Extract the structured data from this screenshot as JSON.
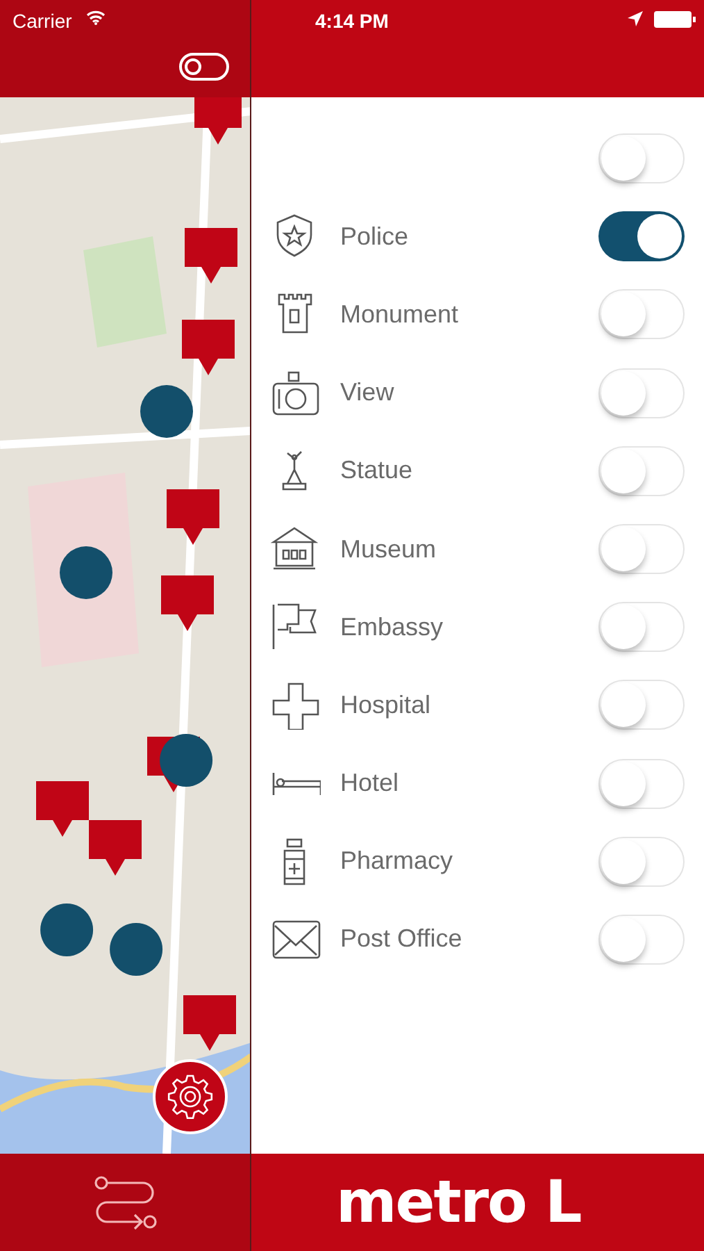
{
  "status_bar": {
    "carrier": "Carrier",
    "time": "4:14 PM"
  },
  "map_toggle": {
    "on": false
  },
  "layers": [
    {
      "kind": "all",
      "on": false
    },
    {
      "kind": "police",
      "label": "Police",
      "on": true
    },
    {
      "kind": "monument",
      "label": "Monument",
      "on": false
    },
    {
      "kind": "view",
      "label": "View",
      "on": false
    },
    {
      "kind": "statue",
      "label": "Statue",
      "on": false
    },
    {
      "kind": "museum",
      "label": "Museum",
      "on": false
    },
    {
      "kind": "embassy",
      "label": "Embassy",
      "on": false
    },
    {
      "kind": "hospital",
      "label": "Hospital",
      "on": false
    },
    {
      "kind": "hotel",
      "label": "Hotel",
      "on": false
    },
    {
      "kind": "pharmacy",
      "label": "Pharmacy",
      "on": false
    },
    {
      "kind": "post",
      "label": "Post Office",
      "on": false
    }
  ],
  "logo": "metro L"
}
